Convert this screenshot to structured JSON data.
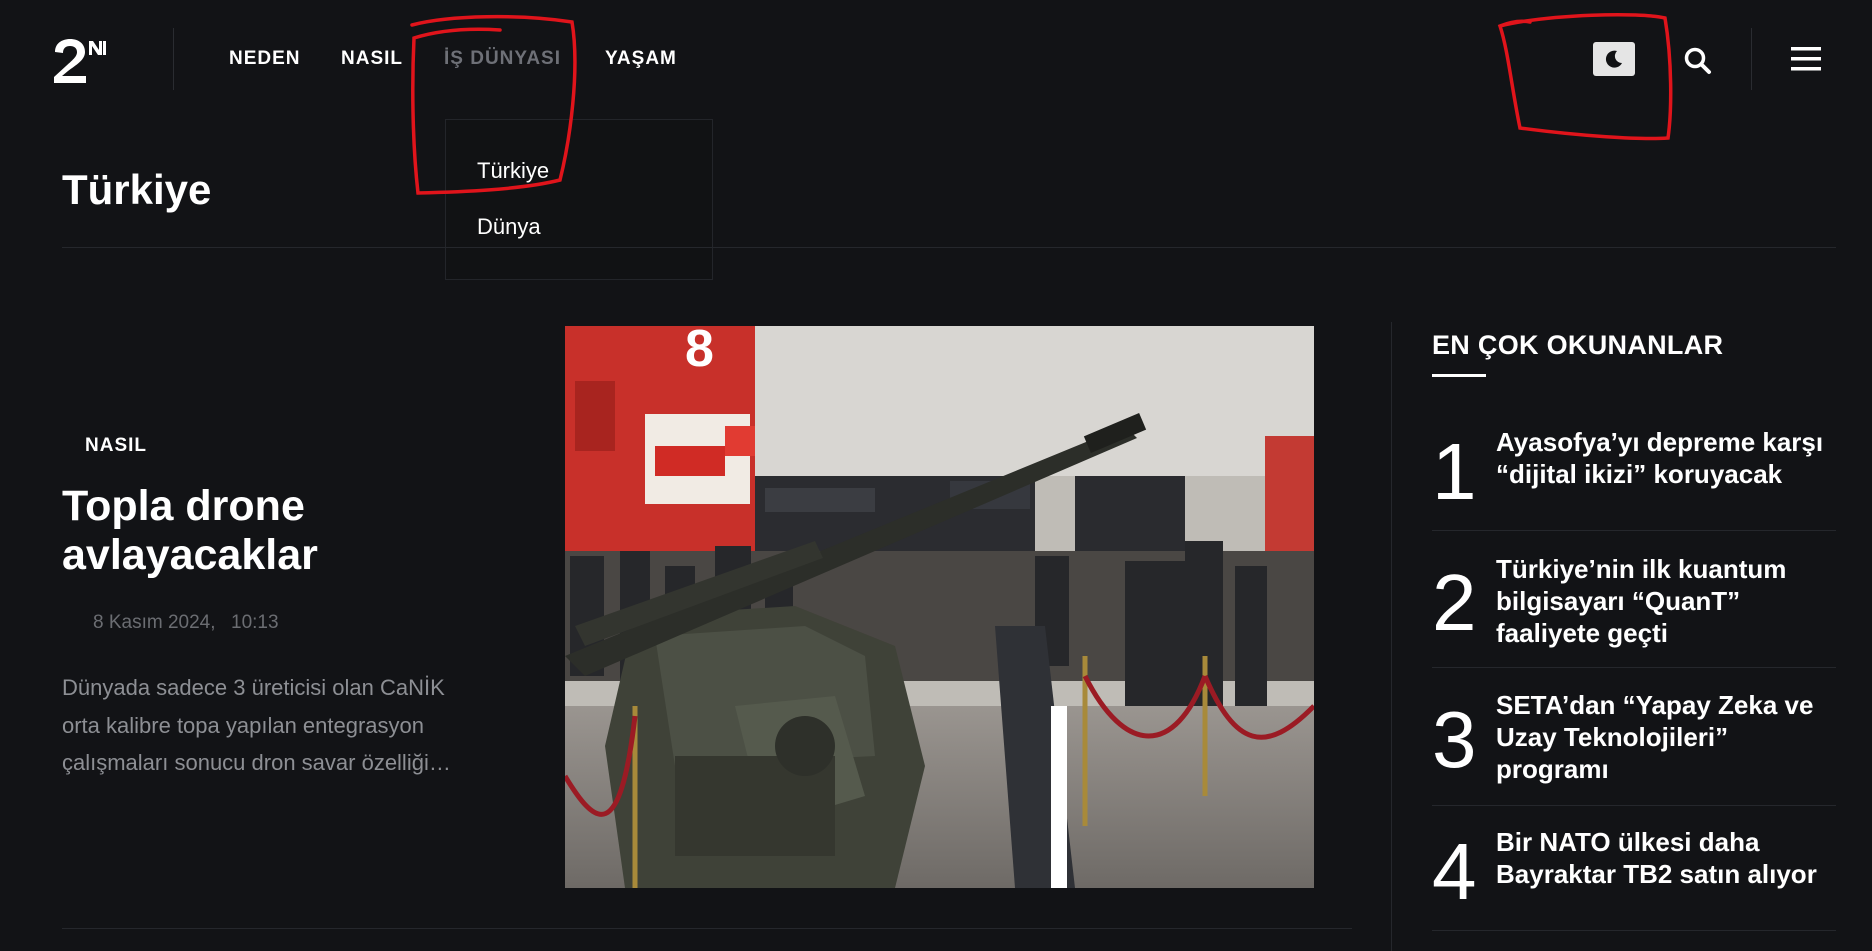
{
  "header": {
    "logo_text": "2N",
    "nav": [
      {
        "label": "NEDEN",
        "active": false
      },
      {
        "label": "NASIL",
        "active": false
      },
      {
        "label": "İŞ DÜNYASI",
        "active": true
      },
      {
        "label": "YAŞAM",
        "active": false
      }
    ],
    "dropdown": [
      "Türkiye",
      "Dünya"
    ],
    "icons": {
      "theme": "moon-icon",
      "search": "search-icon",
      "menu": "hamburger-icon"
    }
  },
  "page": {
    "section_title": "Türkiye"
  },
  "featured": {
    "category": "NASIL",
    "title": "Topla drone avlayacaklar",
    "date": "8 Kasım 2024,",
    "time": "10:13",
    "excerpt": "Dünyada sadece 3 üreticisi olan CaNİK orta kalibre topa yapılan entegrasyon çalışmaları sonucu dron savar özelliği…"
  },
  "sidebar": {
    "title": "EN ÇOK OKUNANLAR",
    "items": [
      {
        "rank": "1",
        "title": "Ayasofya’yı depreme karşı “dijital ikizi” koruyacak"
      },
      {
        "rank": "2",
        "title": "Türkiye’nin ilk kuantum bilgisayarı “QuanT” faaliyete geçti"
      },
      {
        "rank": "3",
        "title": "SETA’dan “Yapay Zeka ve Uzay Teknolojileri” programı"
      },
      {
        "rank": "4",
        "title": "Bir NATO ülkesi daha Bayraktar TB2 satın alıyor"
      }
    ]
  },
  "colors": {
    "background": "#121316",
    "text": "#ffffff",
    "muted": "#8d8f94",
    "annotation": "#e0141b"
  }
}
